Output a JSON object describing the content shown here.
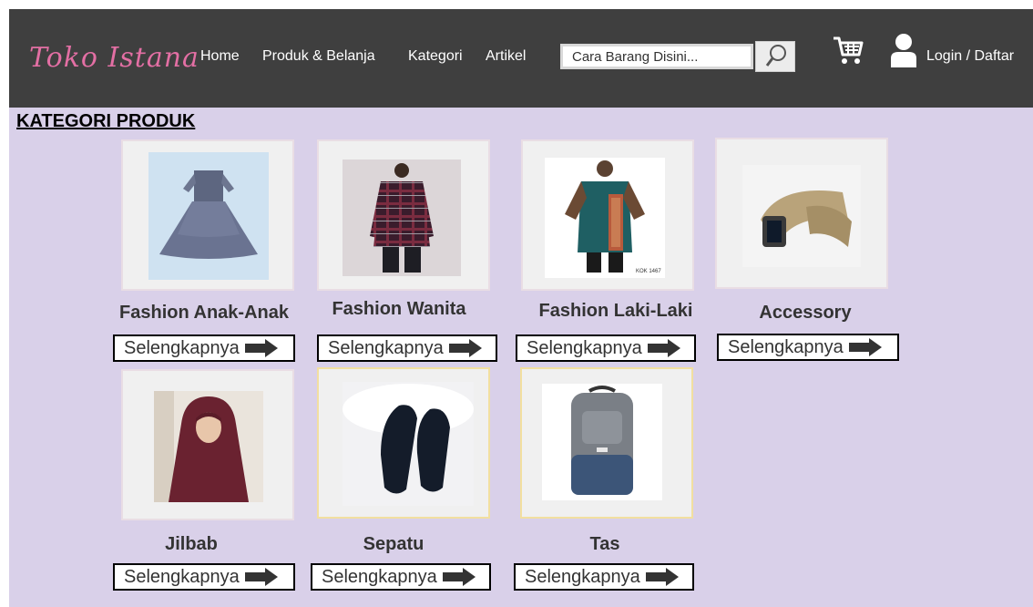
{
  "header": {
    "logo": "Toko Istana",
    "nav": [
      "Home",
      "Produk & Belanja",
      "Kategori",
      "Artikel"
    ],
    "search_placeholder": "Cara Barang Disini...",
    "login": "Login / Daftar"
  },
  "section_title": "KATEGORI PRODUK",
  "categories": [
    {
      "label": "Fashion Anak-Anak",
      "button": "Selengkapnya"
    },
    {
      "label": "Fashion Wanita",
      "button": "Selengkapnya"
    },
    {
      "label": "Fashion Laki-Laki",
      "button": "Selengkapnya"
    },
    {
      "label": "Accessory",
      "button": "Selengkapnya"
    },
    {
      "label": "Jilbab",
      "button": "Selengkapnya"
    },
    {
      "label": "Sepatu",
      "button": "Selengkapnya"
    },
    {
      "label": "Tas",
      "button": "Selengkapnya"
    }
  ],
  "product_image_tag": "KOK 1467",
  "colors": {
    "navbar": "#3f3f3f",
    "background": "#d9d0e9",
    "logo": "#e36fa4"
  },
  "icons": [
    "search-icon",
    "cart-icon",
    "user-icon",
    "arrow-right-icon"
  ]
}
